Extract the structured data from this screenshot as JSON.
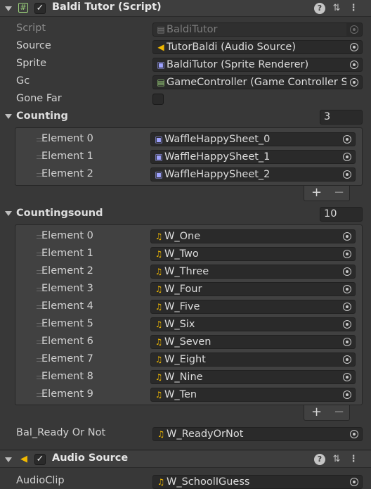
{
  "colors": {
    "background": "#383838",
    "field": "#2a2a2a",
    "audio_icon": "#f0b800",
    "sprite_icon": "#9ea2ff",
    "script_icon": "#9ad07a"
  },
  "baldi": {
    "title": "Baldi Tutor (Script)",
    "enabled": true,
    "icons": {
      "component": "script-icon",
      "help": "help-icon",
      "settings": "preset-icon",
      "menu": "kebab-icon"
    },
    "fields": {
      "script": {
        "label": "Script",
        "value": "BaldiTutor",
        "icon": "script-icon"
      },
      "source": {
        "label": "Source",
        "value": "TutorBaldi (Audio Source)",
        "icon": "audio-source-icon"
      },
      "sprite": {
        "label": "Sprite",
        "value": "BaldiTutor (Sprite Renderer)",
        "icon": "sprite-renderer-icon"
      },
      "gc": {
        "label": "Gc",
        "value": "GameController (Game Controller Sc",
        "icon": "script-icon"
      },
      "gone_far": {
        "label": "Gone Far",
        "checked": false
      }
    },
    "counting": {
      "label": "Counting",
      "size": "3",
      "elements": [
        {
          "label": "Element 0",
          "value": "WaffleHappySheet_0"
        },
        {
          "label": "Element 1",
          "value": "WaffleHappySheet_1"
        },
        {
          "label": "Element 2",
          "value": "WaffleHappySheet_2"
        }
      ],
      "add": "+",
      "remove": "−"
    },
    "countingsound": {
      "label": "Countingsound",
      "size": "10",
      "elements": [
        {
          "label": "Element 0",
          "value": "W_One"
        },
        {
          "label": "Element 1",
          "value": "W_Two"
        },
        {
          "label": "Element 2",
          "value": "W_Three"
        },
        {
          "label": "Element 3",
          "value": "W_Four"
        },
        {
          "label": "Element 4",
          "value": "W_Five"
        },
        {
          "label": "Element 5",
          "value": "W_Six"
        },
        {
          "label": "Element 6",
          "value": "W_Seven"
        },
        {
          "label": "Element 7",
          "value": "W_Eight"
        },
        {
          "label": "Element 8",
          "value": "W_Nine"
        },
        {
          "label": "Element 9",
          "value": "W_Ten"
        }
      ],
      "add": "+",
      "remove": "−"
    },
    "bal_ready": {
      "label": "Bal_Ready Or Not",
      "value": "W_ReadyOrNot"
    }
  },
  "audio_source": {
    "title": "Audio Source",
    "enabled": true,
    "audio_clip": {
      "label": "AudioClip",
      "value": "W_SchoolIGuess"
    }
  }
}
